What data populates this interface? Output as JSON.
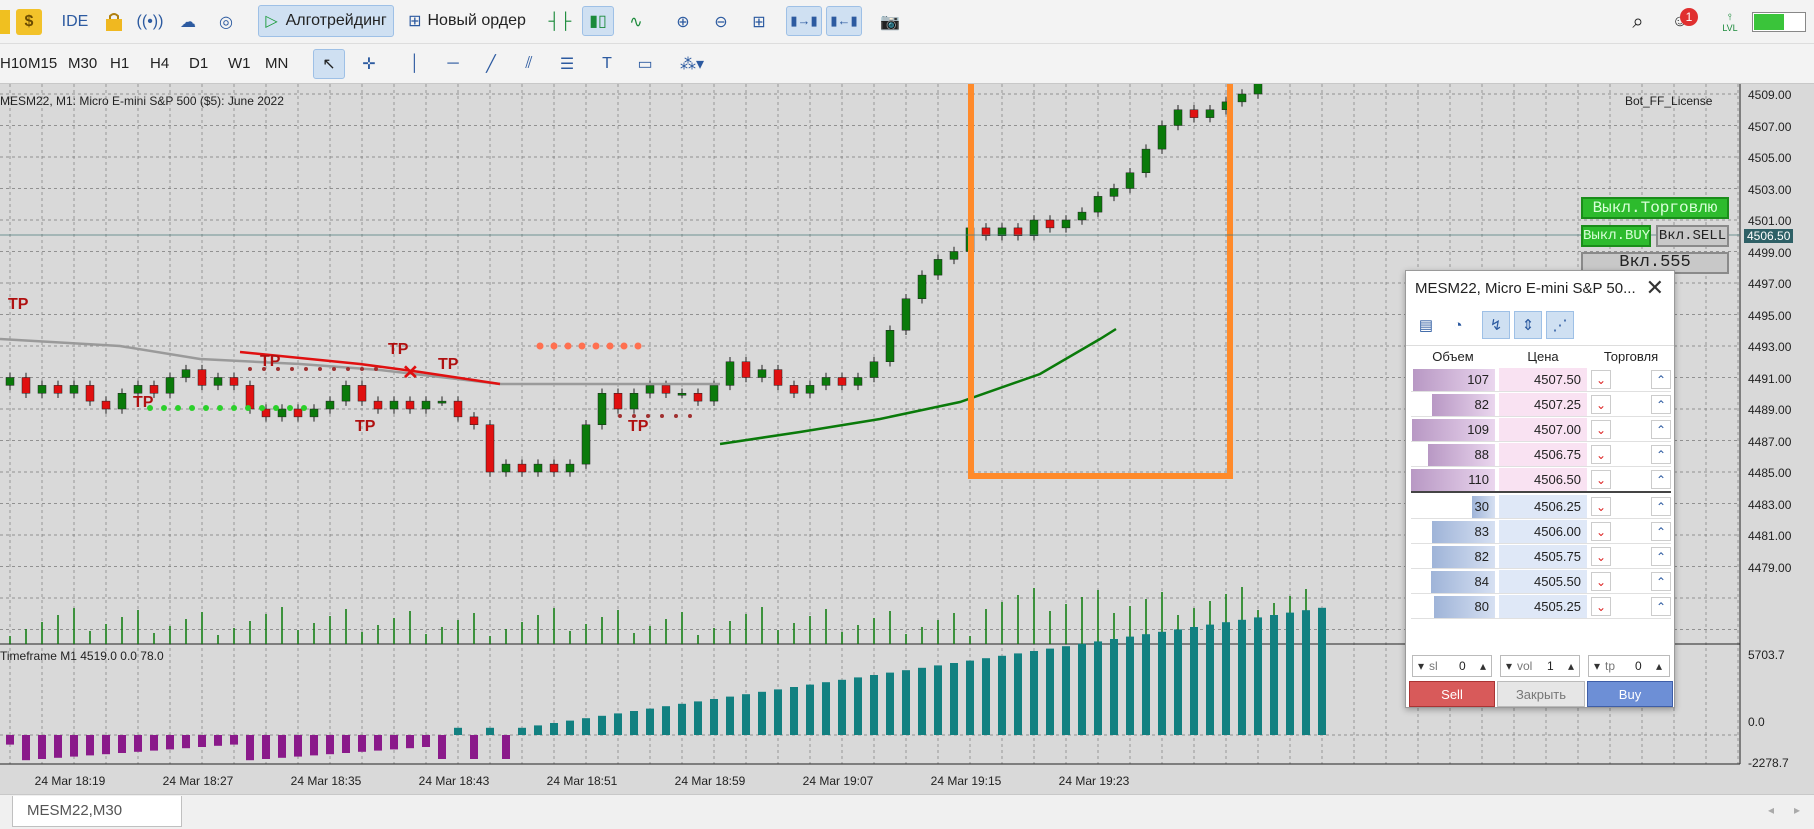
{
  "toolbar": {
    "ide_label": "IDE",
    "algo_label": "Алготрейдинг",
    "new_order_label": "Новый ордер",
    "notification_count": "1",
    "lvl_label": "LVL"
  },
  "timeframes": [
    "H10",
    "M15",
    "M30",
    "H1",
    "H4",
    "D1",
    "W1",
    "MN"
  ],
  "chart": {
    "title": "MESM22, M1:  Micro E-mini S&P 500 ($5): June 2022",
    "license_label": "Bot_FF_License",
    "current_price_tag": "4506.50",
    "buttons": {
      "off_trade": "Выкл.Торговлю",
      "off_buy": "Выкл.BUY",
      "on_sell": "Вкл.SELL",
      "on_555": "Вкл.555"
    },
    "indicator_label": "Timeframe M1 4519.0 0.0 78.0",
    "price_labels": [
      "4509.00",
      "4507.00",
      "4505.00",
      "4503.00",
      "4501.00",
      "4499.00",
      "4497.00",
      "4495.00",
      "4493.00",
      "4491.00",
      "4489.00",
      "4487.00",
      "4485.00",
      "4483.00",
      "4481.00",
      "4479.00"
    ],
    "indicator_scale": [
      "5703.7",
      "0.0",
      "-2278.7"
    ],
    "time_labels": [
      "24 Mar 18:19",
      "24 Mar 18:27",
      "24 Mar 18:35",
      "24 Mar 18:43",
      "24 Mar 18:51",
      "24 Mar 18:59",
      "24 Mar 19:07",
      "24 Mar 19:15",
      "24 Mar 19:23"
    ],
    "tp_label": "TP",
    "colors": {
      "bull": "#0a7a0a",
      "bear": "#e01010",
      "ma": "#0a7a0a",
      "hist_pos": "#128080",
      "hist_neg": "#8a1a8a",
      "highlight": "#ff8a2a"
    }
  },
  "dom": {
    "title": "MESM22, Micro E-mini S&P 50...",
    "col_volume": "Объем",
    "col_price": "Цена",
    "col_trade": "Торговля",
    "asks": [
      {
        "volume": "107",
        "price": "4507.50"
      },
      {
        "volume": "82",
        "price": "4507.25"
      },
      {
        "volume": "109",
        "price": "4507.00"
      },
      {
        "volume": "88",
        "price": "4506.75"
      },
      {
        "volume": "110",
        "price": "4506.50"
      }
    ],
    "bids": [
      {
        "volume": "30",
        "price": "4506.25"
      },
      {
        "volume": "83",
        "price": "4506.00"
      },
      {
        "volume": "82",
        "price": "4505.75"
      },
      {
        "volume": "84",
        "price": "4505.50"
      },
      {
        "volume": "80",
        "price": "4505.25"
      }
    ],
    "sl_placeholder": "sl",
    "sl_value": "0",
    "vol_placeholder": "vol",
    "vol_value": "1",
    "tp_placeholder": "tp",
    "tp_value": "0",
    "sell_label": "Sell",
    "close_label": "Закрыть",
    "buy_label": "Buy"
  },
  "tabs": {
    "active": "MESM22,M30"
  }
}
